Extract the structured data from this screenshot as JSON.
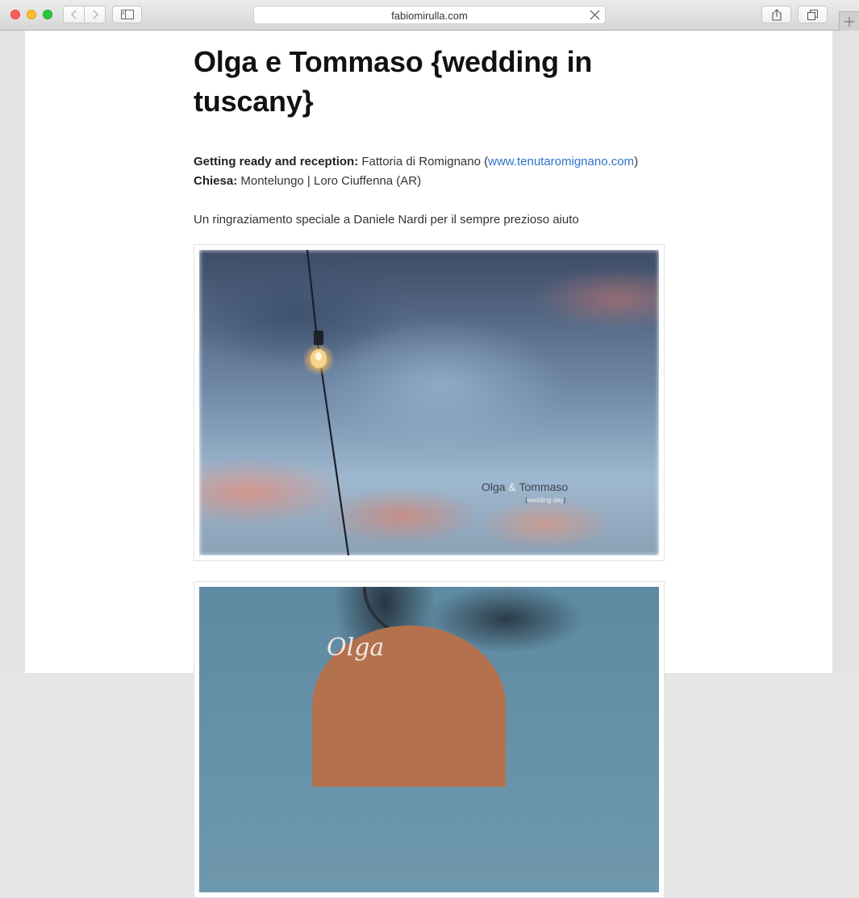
{
  "browser": {
    "address": "fabiomirulla.com"
  },
  "post": {
    "title": "Olga e Tommaso {wedding in tuscany}",
    "getting_ready_label": "Getting ready and reception:",
    "getting_ready_value": "Fattoria di Romignano (",
    "getting_ready_link": "www.tenutaromignano.com",
    "getting_ready_close": ")",
    "chiesa_label": "Chiesa:",
    "chiesa_value": "Montelungo | Loro Ciuffenna (AR)",
    "thanks": "Un ringraziamento speciale a Daniele Nardi per il sempre prezioso aiuto"
  },
  "photos": [
    {
      "name_first": "Olga",
      "ampersand": "&",
      "name_second": "Tommaso",
      "sub_open": "{",
      "sub": "wedding day",
      "sub_close": "}"
    },
    {
      "hanger_text": "Olga"
    }
  ]
}
